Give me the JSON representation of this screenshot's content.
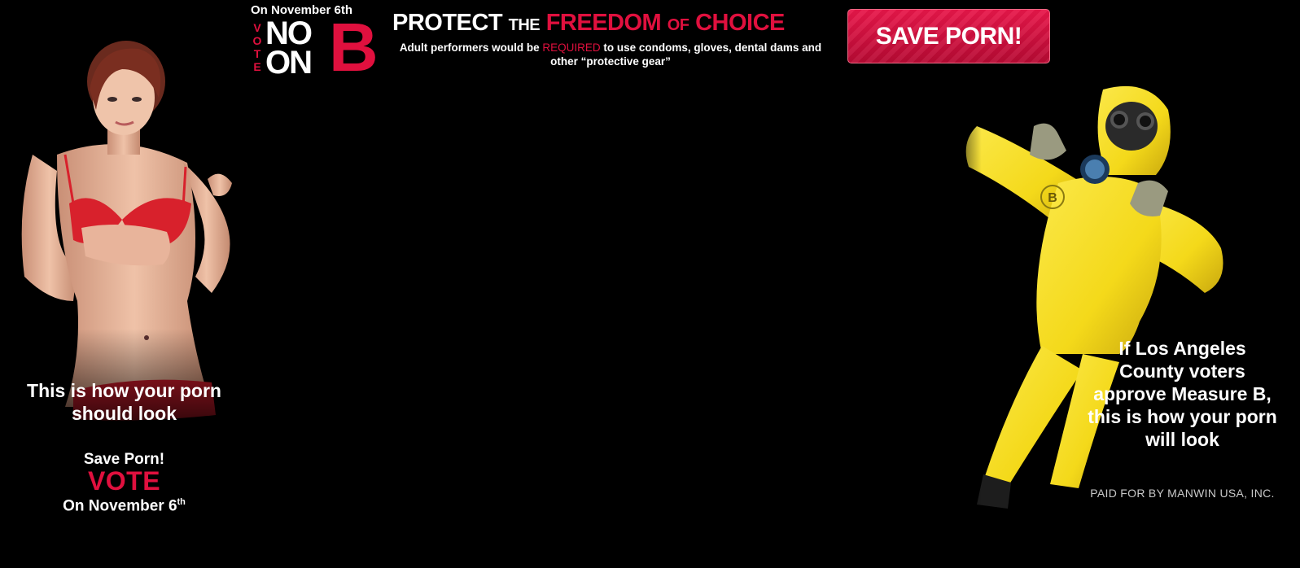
{
  "logo": {
    "date_line": "On November 6th",
    "vote_letters": [
      "V",
      "O",
      "T",
      "E"
    ],
    "no": "NO",
    "on": "ON",
    "letter": "B"
  },
  "headline": {
    "protect": "PROTECT",
    "the": "THE",
    "freedom": "FREEDOM",
    "of": "OF",
    "choice": "CHOICE",
    "sub_before": "Adult performers would be",
    "sub_required": "REQUIRED",
    "sub_after": "to use condoms, gloves, dental dams and other “protective gear”"
  },
  "save_button": {
    "label": "SAVE PORN!"
  },
  "left": {
    "caption_line1": "This is how your porn",
    "caption_line2": "should look",
    "save": "Save Porn!",
    "vote": "VOTE",
    "date_main": "On November 6",
    "date_sup": "th"
  },
  "right": {
    "caption_lines": [
      "If Los Angeles",
      "County voters",
      "approve Measure B,",
      "this is how your porn",
      "will look"
    ],
    "badge_letter": "B",
    "paid_for": "PAID FOR BY MANWIN USA, INC."
  },
  "colors": {
    "accent_red": "#e0103e",
    "hazmat_yellow": "#f4d91a",
    "background": "#000000"
  }
}
